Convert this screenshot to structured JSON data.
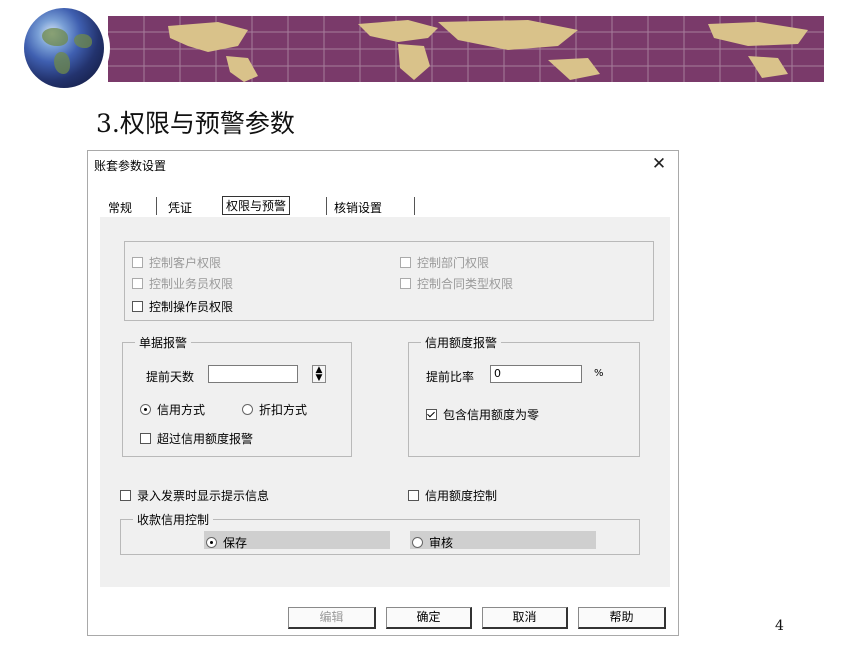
{
  "slide": {
    "title": "3.权限与预警参数",
    "page_number": "4"
  },
  "dialog": {
    "title": "账套参数设置",
    "close_icon": "close-icon",
    "tabs": [
      {
        "label": "常规"
      },
      {
        "label": "凭证"
      },
      {
        "label": "权限与预警"
      },
      {
        "label": "核销设置"
      }
    ],
    "active_tab": "权限与预警",
    "permissions": {
      "control_customer": "控制客户权限",
      "control_department": "控制部门权限",
      "control_salesperson": "控制业务员权限",
      "control_contract_type": "控制合同类型权限",
      "control_operator": "控制操作员权限"
    },
    "doc_warning": {
      "title": "单据报警",
      "advance_days_label": "提前天数",
      "advance_days_value": "",
      "radio_credit": "信用方式",
      "radio_discount": "折扣方式",
      "selected_radio": "信用方式",
      "over_credit_label": "超过信用额度报警"
    },
    "credit_warning": {
      "title": "信用额度报警",
      "advance_ratio_label": "提前比率",
      "advance_ratio_value": "0",
      "percent_unit": "%",
      "include_zero_label": "包含信用额度为零",
      "include_zero_checked": true
    },
    "show_invoice_hint_label": "录入发票时显示提示信息",
    "credit_control_label": "信用额度控制",
    "receipt_credit": {
      "title": "收款信用控制",
      "option_save": "保存",
      "option_audit": "审核",
      "selected": "保存"
    },
    "buttons": {
      "edit": "编辑",
      "ok": "确定",
      "cancel": "取消",
      "help": "帮助"
    }
  }
}
